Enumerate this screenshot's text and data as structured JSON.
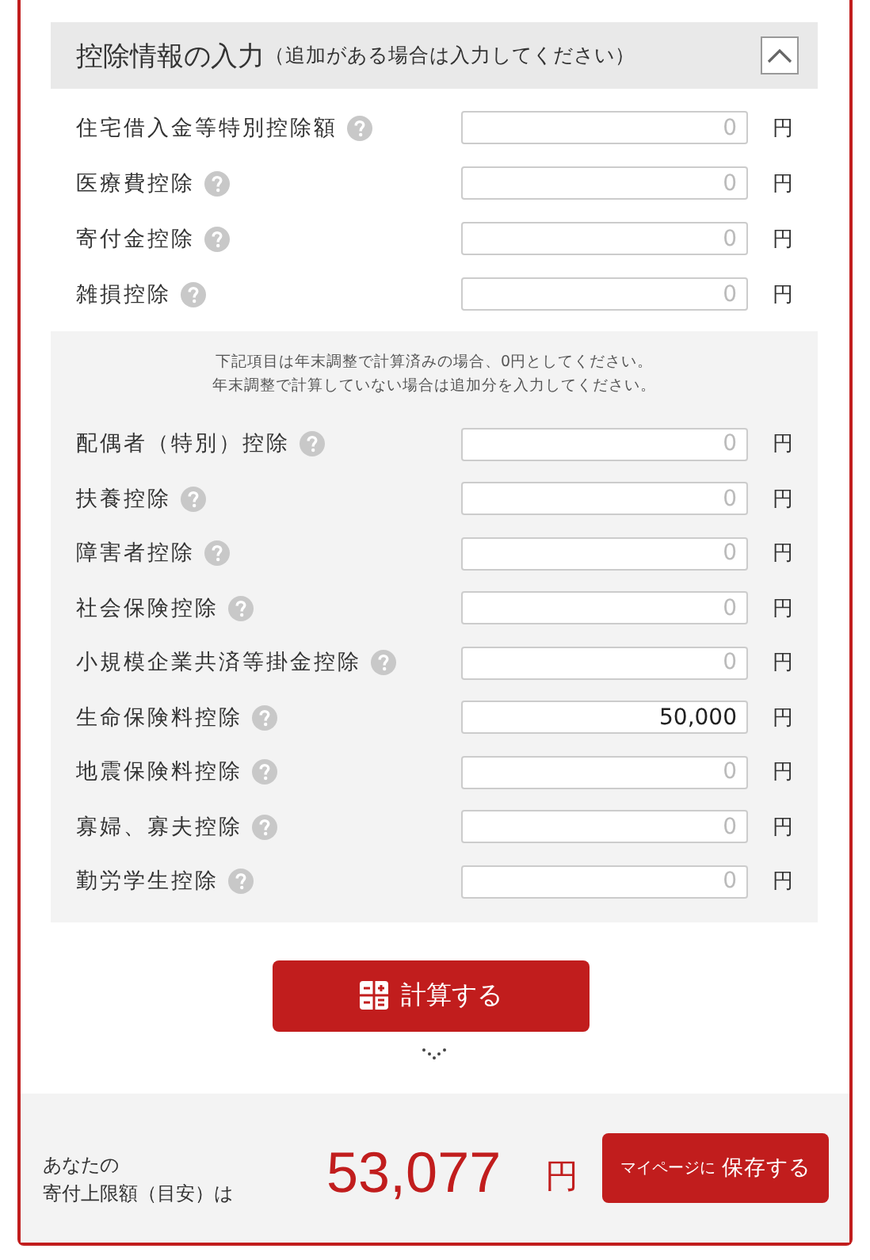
{
  "section": {
    "title": "控除情報の入力",
    "subtitle": "（追加がある場合は入力してください）",
    "expanded": true
  },
  "rows": [
    {
      "label": "住宅借入金等特別控除額",
      "placeholder": "0",
      "unit": "円"
    },
    {
      "label": "医療費控除",
      "placeholder": "0",
      "unit": "円"
    },
    {
      "label": "寄付金控除",
      "placeholder": "0",
      "unit": "円"
    },
    {
      "label": "雑損控除",
      "placeholder": "0",
      "unit": "円"
    }
  ],
  "note": {
    "lines": [
      "下記項目は年末調整で計算済みの場合、0円としてください。",
      "年末調整で計算していない場合は追加分を入力してください。"
    ],
    "rows": [
      {
        "label": "配偶者（特別）控除",
        "placeholder": "0",
        "unit": "円"
      },
      {
        "label": "扶養控除",
        "placeholder": "0",
        "unit": "円"
      },
      {
        "label": "障害者控除",
        "placeholder": "0",
        "unit": "円"
      },
      {
        "label": "社会保険控除",
        "placeholder": "0",
        "unit": "円"
      },
      {
        "label": "小規模企業共済等掛金控除",
        "placeholder": "0",
        "unit": "円"
      },
      {
        "label": "生命保険料控除",
        "value": "50,000",
        "unit": "円"
      },
      {
        "label": "地震保険料控除",
        "placeholder": "0",
        "unit": "円"
      },
      {
        "label": "寡婦、寡夫控除",
        "placeholder": "0",
        "unit": "円"
      },
      {
        "label": "勤労学生控除",
        "placeholder": "0",
        "unit": "円"
      }
    ]
  },
  "calculate_button": "計算する",
  "result": {
    "label_lines": [
      "あなたの",
      "寄付上限額（目安）は"
    ],
    "amount": "53,077",
    "unit": "円",
    "save_button": {
      "prefix": "マイページに",
      "label": "保存する"
    }
  }
}
